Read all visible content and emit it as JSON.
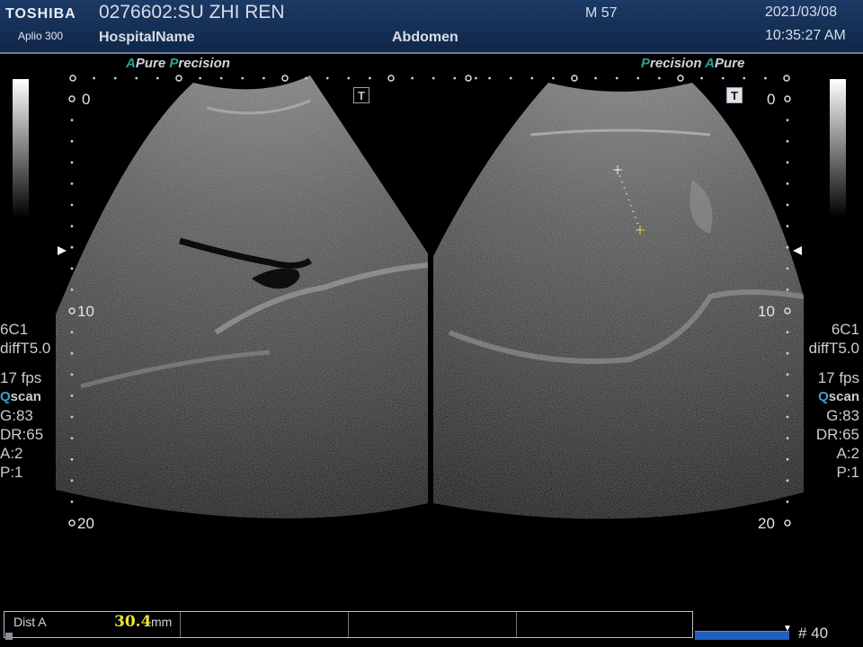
{
  "header": {
    "brand": "TOSHIBA",
    "model": "Aplio 300",
    "patient": "0276602:SU ZHI REN",
    "hospital": "HospitalName",
    "region": "Abdomen",
    "age_sex": "M 57",
    "date": "2021/03/08",
    "time": "10:35:27 AM"
  },
  "left_image": {
    "mode_a": "A",
    "mode_pure": "Pure",
    "mode_p": "P",
    "mode_precision": "recision",
    "depth_top": "0",
    "depth_mid": "10",
    "depth_bottom": "20",
    "t_icon": "T"
  },
  "right_image": {
    "mode_p": "P",
    "mode_precision": "recision",
    "mode_a": "A",
    "mode_pure": "Pure",
    "depth_top": "0",
    "depth_mid": "10",
    "depth_bottom": "20",
    "t_icon": "T"
  },
  "params_left": {
    "probe": "6C1",
    "filter": "diffT5.0",
    "fps": "17 fps",
    "q_letter": "Q",
    "q_word": "scan",
    "gain": "G:83",
    "dr": "DR:65",
    "a": "A:2",
    "p": "P:1"
  },
  "params_right": {
    "probe": "6C1",
    "filter": "diffT5.0",
    "fps": "17 fps",
    "q_letter": "Q",
    "q_word": "scan",
    "gain": "G:83",
    "dr": "DR:65",
    "a": "A:2",
    "p": "P:1"
  },
  "measurement": {
    "label": "Dist A",
    "value": "30.4",
    "unit": "mm"
  },
  "cine": {
    "frame": "# 40",
    "marker_icon": "triangle-down-icon"
  },
  "colors": {
    "header_bg": "#1c3a66",
    "mode_accent": "#2aa39a",
    "measure_value": "#f0e33a",
    "cine_bar": "#1e5fc0"
  }
}
